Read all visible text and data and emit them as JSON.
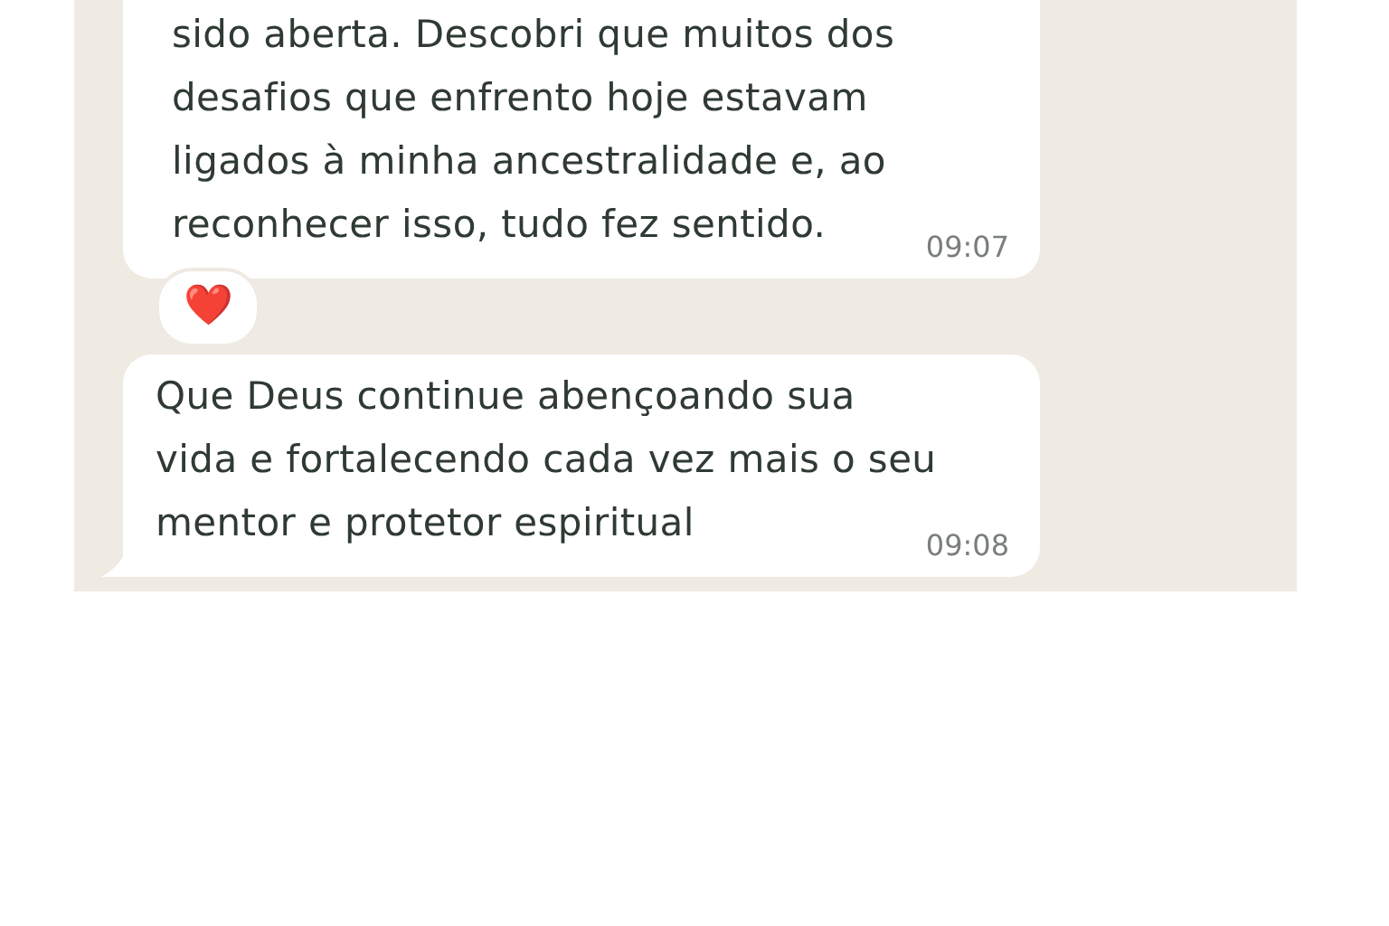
{
  "messages": [
    {
      "lines": [
        "sido aberta. Descobri que muitos dos",
        "desafios que enfrento hoje estavam",
        "ligados à minha ancestralidade e, ao",
        "reconhecer isso, tudo fez sentido."
      ],
      "time": "09:07",
      "reaction": "❤️",
      "tail": false
    },
    {
      "lines": [
        "Que Deus continue abençoando sua",
        "vida e fortalecendo cada vez mais o seu",
        "mentor e protetor espiritual"
      ],
      "time": "09:08",
      "tail": true
    }
  ]
}
